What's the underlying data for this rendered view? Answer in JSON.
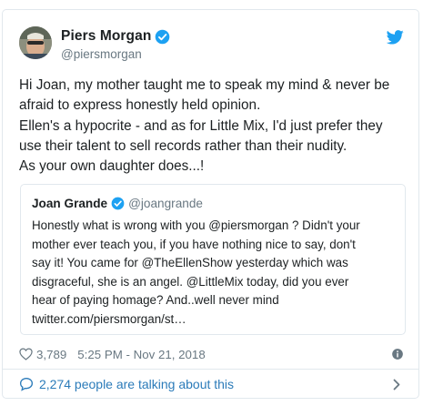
{
  "tweet": {
    "author": {
      "display_name": "Piers Morgan",
      "handle": "@piersmorgan",
      "verified": true
    },
    "text_lines": [
      "Hi Joan, my mother taught me to speak my mind & never be",
      "afraid to express honestly held opinion.",
      "Ellen's a hypocrite - and as for Little Mix, I'd just prefer they",
      "use their talent to sell records rather than their nudity.",
      "As your own daughter does...!"
    ],
    "quoted": {
      "display_name": "Joan Grande",
      "handle": "@joangrande",
      "verified": true,
      "text_lines": [
        "Honestly what is wrong with you @piersmorgan ? Didn't your",
        "mother ever teach you, if you have nothing nice to say, don't",
        "say it! You came for @TheEllenShow yesterday which was",
        "disgraceful, she is an angel. @LittleMix today, did you ever",
        "hear of paying homage? And..well never mind",
        "twitter.com/piersmorgan/st…"
      ]
    },
    "likes": "3,789",
    "timestamp": "5:25 PM - Nov 21, 2018",
    "conversation": "2,274 people are talking about this"
  },
  "icons": {
    "brand": "twitter-bird-icon",
    "verified": "verified-badge-icon",
    "like": "heart-icon",
    "info": "info-icon",
    "conversation": "speech-bubble-icon",
    "more": "chevron-right-icon"
  },
  "colors": {
    "twitter_blue": "#1da1f2",
    "link_blue": "#2b7bb9",
    "text": "#1c2022",
    "muted": "#697882",
    "border": "#e1e8ed"
  }
}
